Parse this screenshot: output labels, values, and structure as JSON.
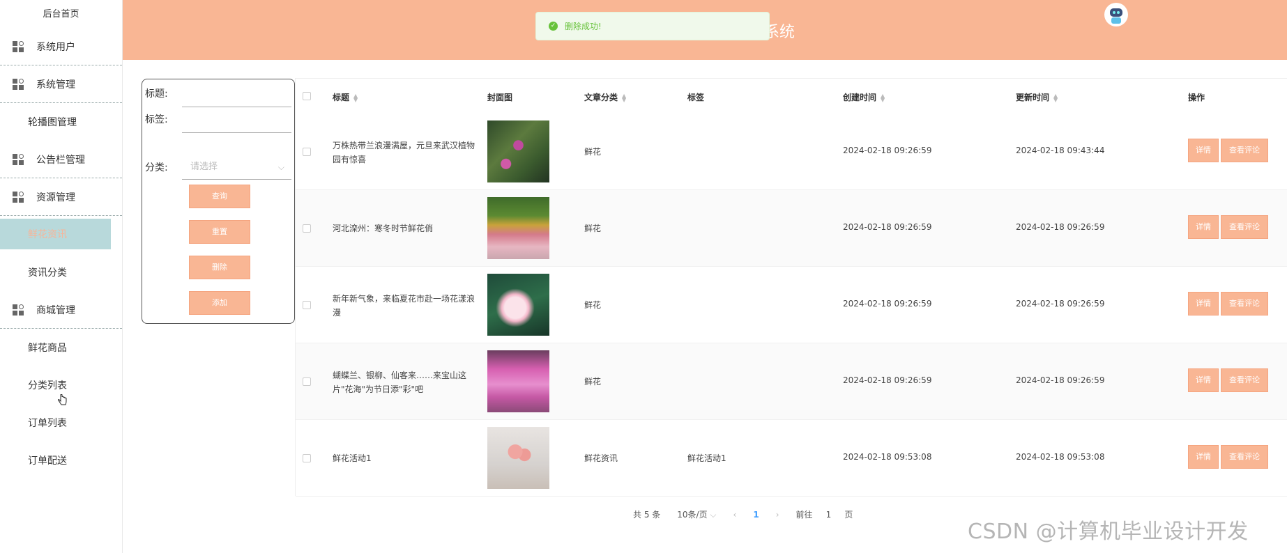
{
  "sidebar": {
    "home": "后台首页",
    "items": [
      {
        "label": "系统用户",
        "type": "group"
      },
      {
        "label": "系统管理",
        "type": "group"
      },
      {
        "label": "轮播图管理",
        "type": "plain"
      },
      {
        "label": "公告栏管理",
        "type": "group"
      },
      {
        "label": "资源管理",
        "type": "group"
      },
      {
        "label": "鲜花资讯",
        "type": "active"
      },
      {
        "label": "资讯分类",
        "type": "plain"
      },
      {
        "label": "商城管理",
        "type": "group"
      },
      {
        "label": "鲜花商品",
        "type": "plain"
      },
      {
        "label": "分类列表",
        "type": "plain"
      },
      {
        "label": "订单列表",
        "type": "plain"
      },
      {
        "label": "订单配送",
        "type": "plain"
      }
    ]
  },
  "header": {
    "title_fragment": "系统",
    "avatar_icon": "robot-avatar-icon"
  },
  "toast": {
    "message": "删除成功!"
  },
  "search": {
    "title_label": "标题:",
    "tag_label": "标签:",
    "category_label": "分类:",
    "category_placeholder": "请选择",
    "buttons": {
      "query": "查询",
      "reset": "重置",
      "delete": "删除",
      "add": "添加"
    }
  },
  "table": {
    "columns": {
      "title": "标题",
      "cover": "封面图",
      "category": "文章分类",
      "tag": "标签",
      "created": "创建时间",
      "updated": "更新时间",
      "ops": "操作"
    },
    "op_labels": {
      "detail": "详情",
      "comments": "查看评论"
    },
    "rows": [
      {
        "title": "万株热带兰浪漫满屋，元旦来武汉植物园有惊喜",
        "category": "鲜花",
        "tag": "",
        "created": "2024-02-18 09:26:59",
        "updated": "2024-02-18 09:43:44",
        "cover": "art1"
      },
      {
        "title": "河北滦州：寒冬时节鲜花俏",
        "category": "鲜花",
        "tag": "",
        "created": "2024-02-18 09:26:59",
        "updated": "2024-02-18 09:26:59",
        "cover": "art2"
      },
      {
        "title": "新年新气象，来临夏花市赴一场花漾浪漫",
        "category": "鲜花",
        "tag": "",
        "created": "2024-02-18 09:26:59",
        "updated": "2024-02-18 09:26:59",
        "cover": "art3"
      },
      {
        "title": "蝴蝶兰、银柳、仙客来……来宝山这片\"花海\"为节日添\"彩\"吧",
        "category": "鲜花",
        "tag": "",
        "created": "2024-02-18 09:26:59",
        "updated": "2024-02-18 09:26:59",
        "cover": "art4"
      },
      {
        "title": "鲜花活动1",
        "category": "鲜花资讯",
        "tag": "鲜花活动1",
        "created": "2024-02-18 09:53:08",
        "updated": "2024-02-18 09:53:08",
        "cover": "art5"
      }
    ]
  },
  "pager": {
    "total": "共 5 条",
    "page_size": "10条/页",
    "current": "1",
    "goto_label": "前往",
    "goto_value": "1",
    "page_suffix": "页"
  },
  "watermark": "CSDN @计算机毕业设计开发"
}
